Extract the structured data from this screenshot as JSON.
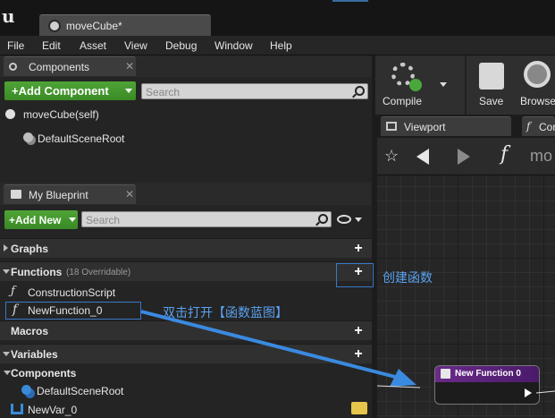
{
  "window": {
    "tab_title": "moveCube*"
  },
  "menu": [
    "File",
    "Edit",
    "Asset",
    "View",
    "Debug",
    "Window",
    "Help"
  ],
  "components_panel": {
    "title": "Components",
    "add_button": "+Add Component",
    "search_placeholder": "Search",
    "items": [
      "moveCube(self)",
      "DefaultSceneRoot"
    ]
  },
  "blueprint_panel": {
    "title": "My Blueprint",
    "add_button": "+Add New",
    "search_placeholder": "Search",
    "categories": {
      "graphs": "Graphs",
      "functions": "Functions",
      "functions_note": "(18 Overridable)",
      "macros": "Macros",
      "variables": "Variables",
      "components": "Components"
    },
    "function_items": [
      "ConstructionScript",
      "NewFunction_0"
    ],
    "component_items": [
      "DefaultSceneRoot"
    ],
    "variable_items": [
      "NewVar_0"
    ]
  },
  "toolbar": {
    "compile": "Compile",
    "save": "Save",
    "browse": "Browse"
  },
  "editor_tabs": {
    "viewport": "Viewport",
    "second": "Cor"
  },
  "graph_nav": {
    "breadcrumb": "mo"
  },
  "graph": {
    "node_title": "New Function 0"
  },
  "annotations": {
    "create_function": "创建函数",
    "double_click_open": "双击打开【函数蓝图】",
    "color": "#3a7ac8"
  }
}
